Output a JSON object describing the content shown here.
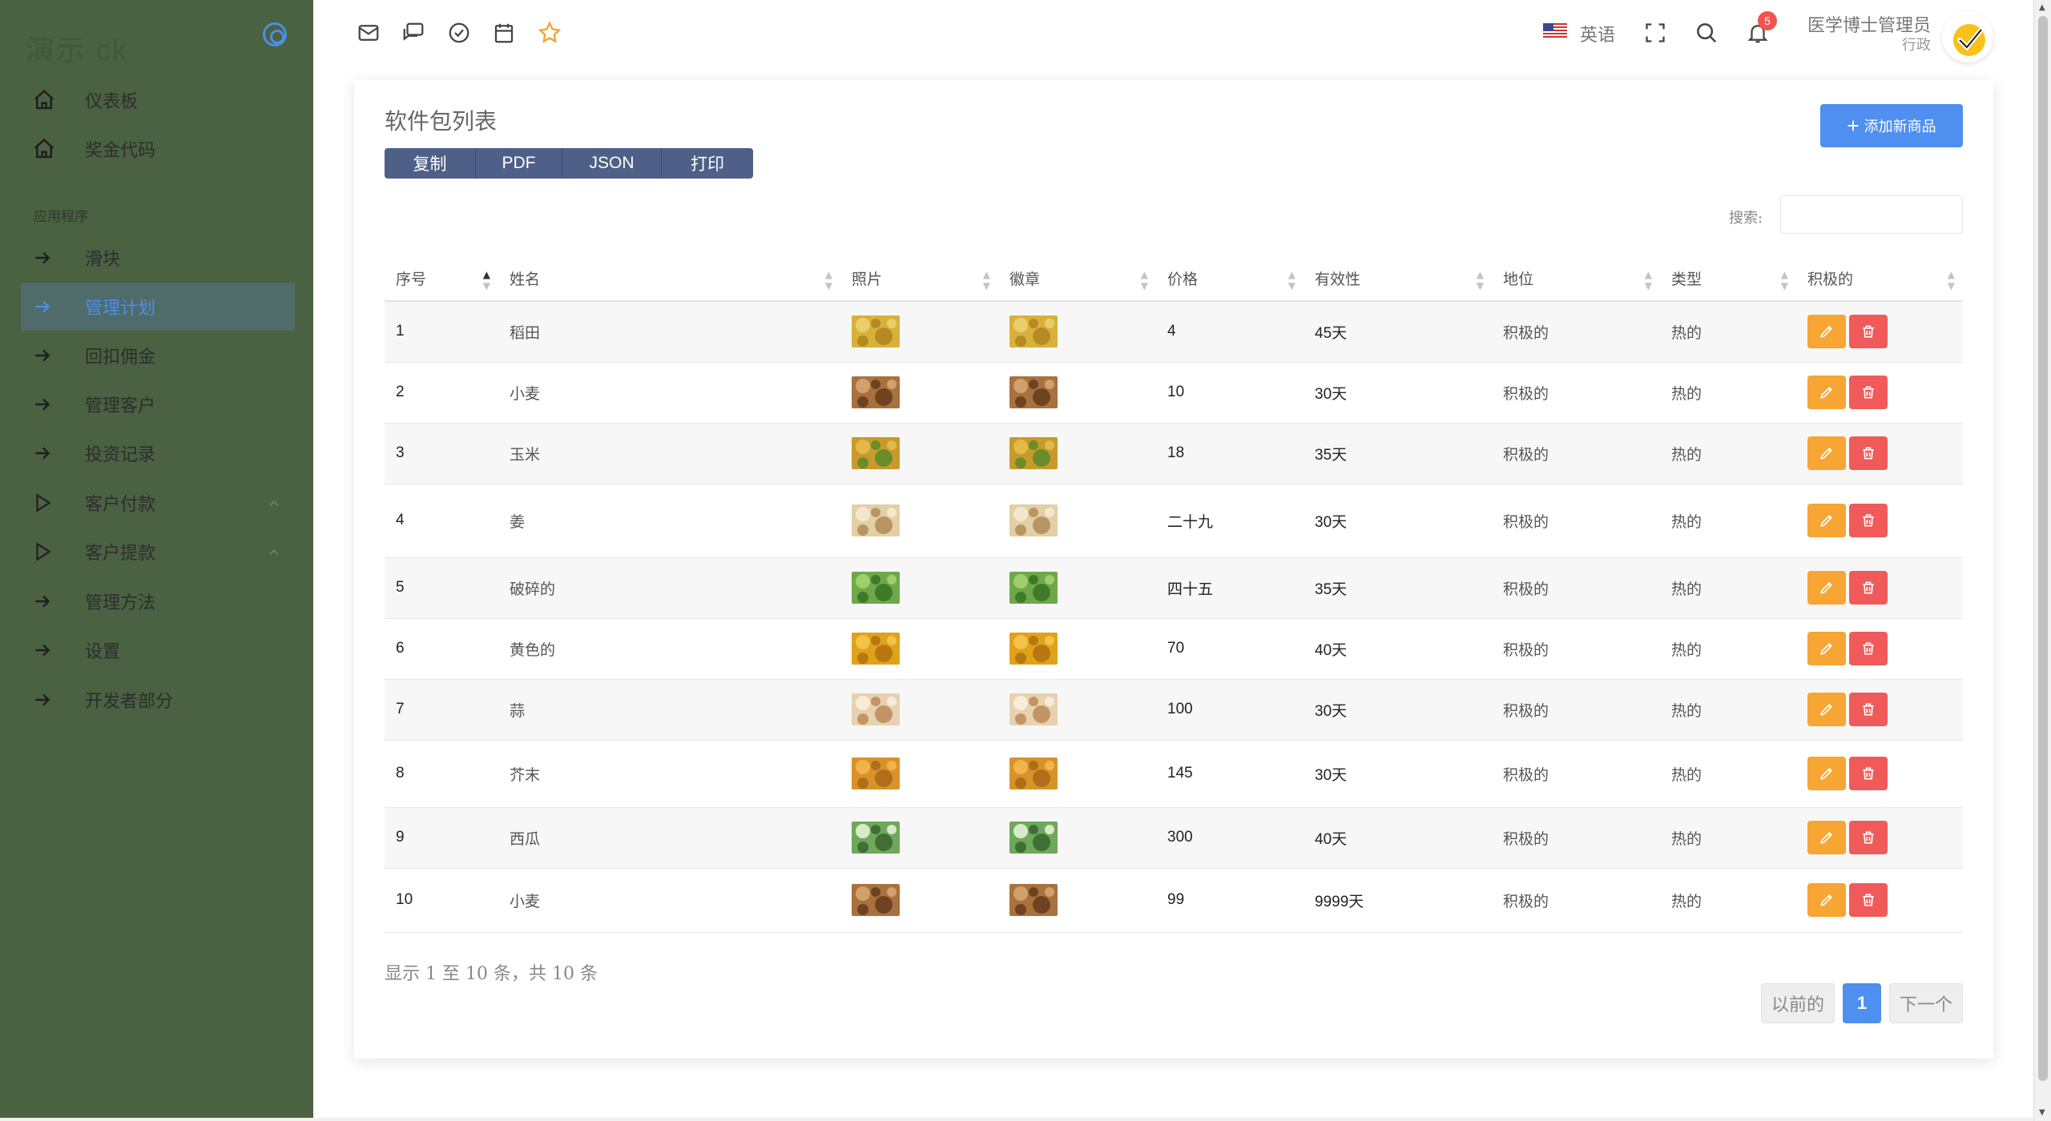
{
  "brand": {
    "name": "演示 ck"
  },
  "sidebar": {
    "section_label": "应用程序",
    "items": [
      {
        "label": "仪表板",
        "icon": "home-icon"
      },
      {
        "label": "奖金代码",
        "icon": "home-icon"
      },
      {
        "label": "滑块",
        "icon": "arrow-right-icon"
      },
      {
        "label": "管理计划",
        "icon": "arrow-right-icon",
        "active": true
      },
      {
        "label": "回扣佣金",
        "icon": "arrow-right-icon"
      },
      {
        "label": "管理客户",
        "icon": "arrow-right-icon"
      },
      {
        "label": "投资记录",
        "icon": "arrow-right-icon"
      },
      {
        "label": "客户付款",
        "icon": "play-icon"
      },
      {
        "label": "客户提款",
        "icon": "play-icon"
      },
      {
        "label": "管理方法",
        "icon": "arrow-right-icon"
      },
      {
        "label": "设置",
        "icon": "arrow-right-icon"
      },
      {
        "label": "开发者部分",
        "icon": "arrow-right-icon"
      }
    ]
  },
  "topbar": {
    "language": "英语",
    "notification_count": "5",
    "user_name": "医学博士管理员",
    "user_role": "行政"
  },
  "card": {
    "title": "软件包列表",
    "export_buttons": [
      "复制",
      "PDF",
      "JSON",
      "打印"
    ],
    "add_button": "添加新商品",
    "search_label": "搜索:"
  },
  "table": {
    "headers": [
      "序号",
      "姓名",
      "照片",
      "徽章",
      "价格",
      "有效性",
      "地位",
      "类型",
      "积极的"
    ],
    "rows": [
      {
        "id": "1",
        "name": "稻田",
        "price": "4",
        "validity": "45天",
        "status": "积极的",
        "type": "热的"
      },
      {
        "id": "2",
        "name": "小麦",
        "price": "10",
        "validity": "30天",
        "status": "积极的",
        "type": "热的"
      },
      {
        "id": "3",
        "name": "玉米",
        "price": "18",
        "validity": "35天",
        "status": "积极的",
        "type": "热的"
      },
      {
        "id": "4",
        "name": "姜",
        "price": "二十九",
        "validity": "30天",
        "status": "积极的",
        "type": "热的"
      },
      {
        "id": "5",
        "name": "破碎的",
        "price": "四十五",
        "validity": "35天",
        "status": "积极的",
        "type": "热的"
      },
      {
        "id": "6",
        "name": "黄色的",
        "price": "70",
        "validity": "40天",
        "status": "积极的",
        "type": "热的"
      },
      {
        "id": "7",
        "name": "蒜",
        "price": "100",
        "validity": "30天",
        "status": "积极的",
        "type": "热的"
      },
      {
        "id": "8",
        "name": "芥末",
        "price": "145",
        "validity": "30天",
        "status": "积极的",
        "type": "热的"
      },
      {
        "id": "9",
        "name": "西瓜",
        "price": "300",
        "validity": "40天",
        "status": "积极的",
        "type": "热的"
      },
      {
        "id": "10",
        "name": "小麦",
        "price": "99",
        "validity": "9999天",
        "status": "积极的",
        "type": "热的"
      }
    ]
  },
  "footer": {
    "info": "显示 1 至 10 条，共 10 条",
    "prev": "以前的",
    "current_page": "1",
    "next": "下一个"
  },
  "colors": {
    "sidebar_bg": "#4a6142",
    "primary": "#4e8ff0",
    "edit": "#f7a533",
    "delete": "#f05a5a",
    "export_group": "#4e6087"
  }
}
